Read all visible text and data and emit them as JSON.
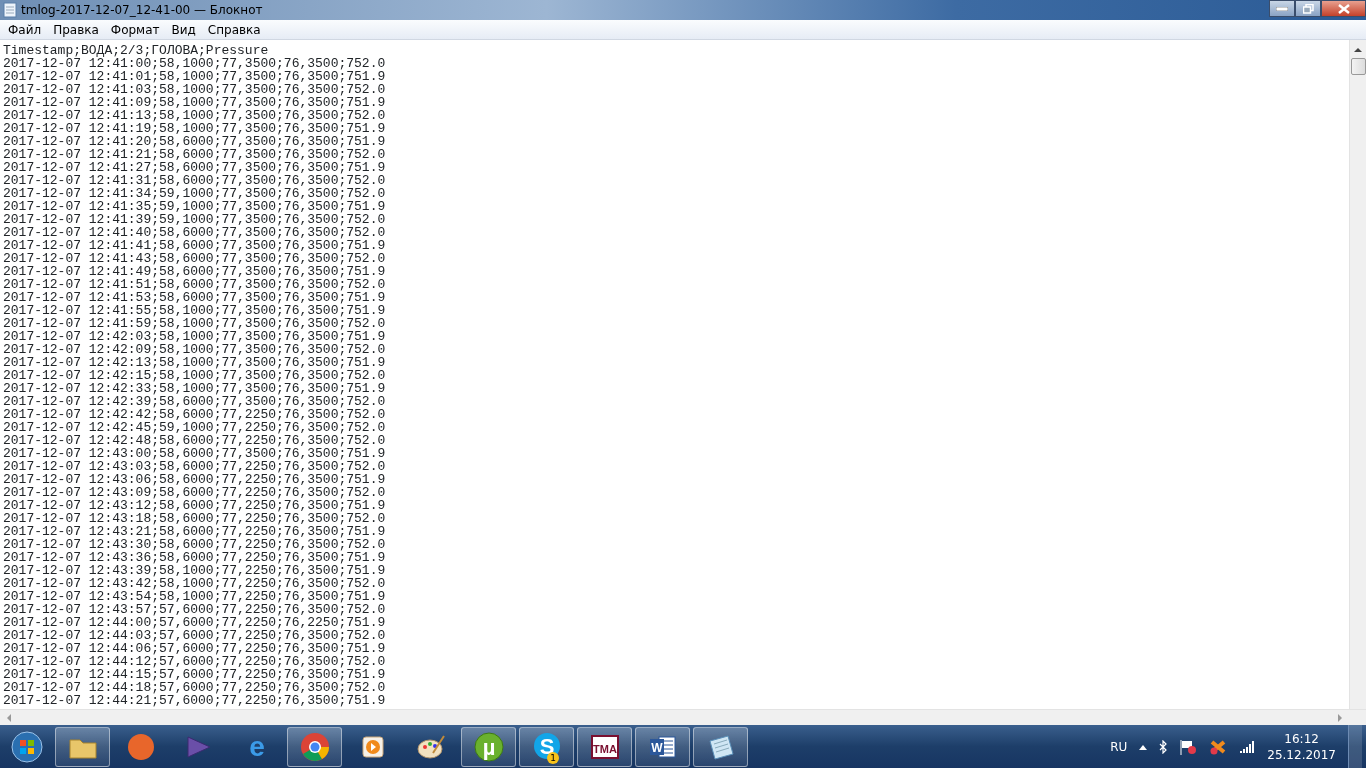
{
  "window": {
    "title": "tmlog-2017-12-07_12-41-00 — Блокнот"
  },
  "menu": [
    "Файл",
    "Правка",
    "Формат",
    "Вид",
    "Справка"
  ],
  "lines": [
    "Timestamp;ВОДА;2/3;ГОЛОВА;Pressure",
    "2017-12-07 12:41:00;58,1000;77,3500;76,3500;752.0",
    "2017-12-07 12:41:01;58,1000;77,3500;76,3500;751.9",
    "2017-12-07 12:41:03;58,1000;77,3500;76,3500;752.0",
    "2017-12-07 12:41:09;58,1000;77,3500;76,3500;751.9",
    "2017-12-07 12:41:13;58,1000;77,3500;76,3500;752.0",
    "2017-12-07 12:41:19;58,1000;77,3500;76,3500;751.9",
    "2017-12-07 12:41:20;58,6000;77,3500;76,3500;751.9",
    "2017-12-07 12:41:21;58,6000;77,3500;76,3500;752.0",
    "2017-12-07 12:41:27;58,6000;77,3500;76,3500;751.9",
    "2017-12-07 12:41:31;58,6000;77,3500;76,3500;752.0",
    "2017-12-07 12:41:34;59,1000;77,3500;76,3500;752.0",
    "2017-12-07 12:41:35;59,1000;77,3500;76,3500;751.9",
    "2017-12-07 12:41:39;59,1000;77,3500;76,3500;752.0",
    "2017-12-07 12:41:40;58,6000;77,3500;76,3500;752.0",
    "2017-12-07 12:41:41;58,6000;77,3500;76,3500;751.9",
    "2017-12-07 12:41:43;58,6000;77,3500;76,3500;752.0",
    "2017-12-07 12:41:49;58,6000;77,3500;76,3500;751.9",
    "2017-12-07 12:41:51;58,6000;77,3500;76,3500;752.0",
    "2017-12-07 12:41:53;58,6000;77,3500;76,3500;751.9",
    "2017-12-07 12:41:55;58,1000;77,3500;76,3500;751.9",
    "2017-12-07 12:41:59;58,1000;77,3500;76,3500;752.0",
    "2017-12-07 12:42:03;58,1000;77,3500;76,3500;751.9",
    "2017-12-07 12:42:09;58,1000;77,3500;76,3500;752.0",
    "2017-12-07 12:42:13;58,1000;77,3500;76,3500;751.9",
    "2017-12-07 12:42:15;58,1000;77,3500;76,3500;752.0",
    "2017-12-07 12:42:33;58,1000;77,3500;76,3500;751.9",
    "2017-12-07 12:42:39;58,6000;77,3500;76,3500;752.0",
    "2017-12-07 12:42:42;58,6000;77,2250;76,3500;752.0",
    "2017-12-07 12:42:45;59,1000;77,2250;76,3500;752.0",
    "2017-12-07 12:42:48;58,6000;77,2250;76,3500;752.0",
    "2017-12-07 12:43:00;58,6000;77,3500;76,3500;751.9",
    "2017-12-07 12:43:03;58,6000;77,2250;76,3500;752.0",
    "2017-12-07 12:43:06;58,6000;77,2250;76,3500;751.9",
    "2017-12-07 12:43:09;58,6000;77,2250;76,3500;752.0",
    "2017-12-07 12:43:12;58,6000;77,2250;76,3500;751.9",
    "2017-12-07 12:43:18;58,6000;77,2250;76,3500;752.0",
    "2017-12-07 12:43:21;58,6000;77,2250;76,3500;751.9",
    "2017-12-07 12:43:30;58,6000;77,2250;76,3500;752.0",
    "2017-12-07 12:43:36;58,6000;77,2250;76,3500;751.9",
    "2017-12-07 12:43:39;58,1000;77,2250;76,3500;751.9",
    "2017-12-07 12:43:42;58,1000;77,2250;76,3500;752.0",
    "2017-12-07 12:43:54;58,1000;77,2250;76,3500;751.9",
    "2017-12-07 12:43:57;57,6000;77,2250;76,3500;752.0",
    "2017-12-07 12:44:00;57,6000;77,2250;76,2250;751.9",
    "2017-12-07 12:44:03;57,6000;77,2250;76,3500;752.0",
    "2017-12-07 12:44:06;57,6000;77,2250;76,3500;751.9",
    "2017-12-07 12:44:12;57,6000;77,2250;76,3500;752.0",
    "2017-12-07 12:44:15;57,6000;77,2250;76,3500;751.9",
    "2017-12-07 12:44:18;57,6000;77,2250;76,3500;752.0",
    "2017-12-07 12:44:21;57,6000;77,2250;76,3500;751.9"
  ],
  "taskbar": {
    "items": [
      {
        "kind": "start",
        "running": false
      },
      {
        "kind": "folder",
        "running": true
      },
      {
        "kind": "orange",
        "running": false
      },
      {
        "kind": "player",
        "running": false
      },
      {
        "kind": "ie",
        "running": false,
        "label": "e"
      },
      {
        "kind": "chrome",
        "running": true
      },
      {
        "kind": "video",
        "running": false
      },
      {
        "kind": "paint",
        "running": false
      },
      {
        "kind": "torrent",
        "running": true,
        "label": "µ"
      },
      {
        "kind": "skype",
        "running": true,
        "label": "S",
        "badge": "1"
      },
      {
        "kind": "tma",
        "running": true,
        "label": "TMA"
      },
      {
        "kind": "word",
        "running": true,
        "label": "W"
      },
      {
        "kind": "notepad",
        "running": true
      }
    ],
    "tray": {
      "language": "RU",
      "time": "16:12",
      "date": "25.12.2017"
    }
  }
}
